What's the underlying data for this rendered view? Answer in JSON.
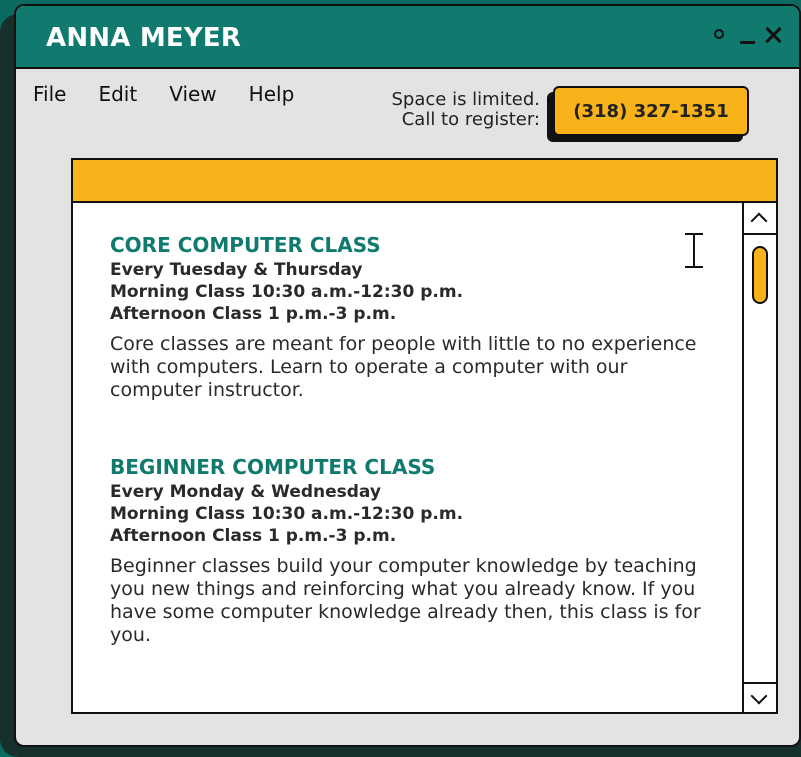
{
  "window": {
    "title": "ANNA MEYER"
  },
  "menubar": {
    "items": [
      {
        "label": "File"
      },
      {
        "label": "Edit"
      },
      {
        "label": "View"
      },
      {
        "label": "Help"
      }
    ]
  },
  "callout": {
    "line1": "Space is limited.",
    "line2": "Call to register:",
    "phone": "(318) 327-1351"
  },
  "content": {
    "sections": [
      {
        "title": "CORE COMPUTER CLASS",
        "schedule": "Every Tuesday & Thursday",
        "morning": "Morning Class 10:30 a.m.-12:30 p.m.",
        "afternoon": "Afternoon Class 1 p.m.-3 p.m.",
        "description": "Core classes are meant for people with little to no experience with computers. Learn to operate a computer with our computer instructor."
      },
      {
        "title": "BEGINNER COMPUTER CLASS",
        "schedule": "Every Monday & Wednesday",
        "morning": "Morning Class 10:30 a.m.-12:30 p.m.",
        "afternoon": "Afternoon Class 1 p.m.-3 p.m.",
        "description": "Beginner classes build your computer knowledge by teaching you new things and reinforcing what you already know. If you have some computer knowledge already then, this class is for you."
      }
    ]
  },
  "icons": {
    "circle": "circle-icon",
    "minimize": "minimize-icon",
    "close": "close-icon",
    "cursor": "text-cursor-icon",
    "scroll_up": "chevron-up-icon",
    "scroll_down": "chevron-down-icon"
  },
  "colors": {
    "brand_teal": "#0f7a6d",
    "accent_orange": "#f8b21a",
    "window_gray": "#e3e3e3",
    "outline": "#111111"
  }
}
